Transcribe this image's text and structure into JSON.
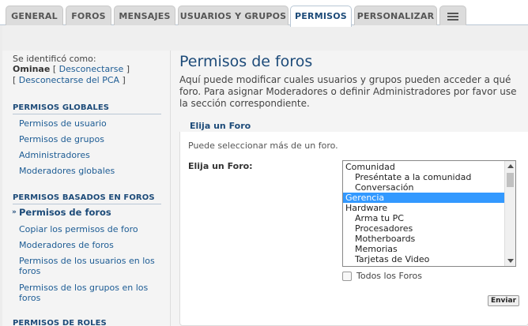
{
  "tabs": [
    {
      "label": "GENERAL",
      "active": false
    },
    {
      "label": "FOROS",
      "active": false
    },
    {
      "label": "MENSAJES",
      "active": false
    },
    {
      "label": "USUARIOS Y GRUPOS",
      "active": false
    },
    {
      "label": "PERMISOS",
      "active": true
    },
    {
      "label": "PERSONALIZAR",
      "active": false
    }
  ],
  "tab_menu_icon": "hamburger-menu-icon",
  "sidebar": {
    "identified_as": "Se identificó como:",
    "username": "Ominae",
    "logout_link": "Desconectarse",
    "logout_pca_link": "Desconectarse del PCA",
    "bracket_open": "[",
    "bracket_close": "]",
    "sections": [
      {
        "title": "PERMISOS GLOBALES",
        "items": [
          {
            "label": "Permisos de usuario"
          },
          {
            "label": "Permisos de grupos"
          },
          {
            "label": "Administradores"
          },
          {
            "label": "Moderadores globales"
          }
        ]
      },
      {
        "title": "PERMISOS BASADOS EN FOROS",
        "items": [
          {
            "label": "Permisos de foros",
            "active": true
          },
          {
            "label": "Copiar los permisos de foro"
          },
          {
            "label": "Moderadores de foros"
          },
          {
            "label": "Permisos de los usuarios en los foros"
          },
          {
            "label": "Permisos de los grupos en los foros"
          }
        ]
      },
      {
        "title": "PERMISOS DE ROLES",
        "items": []
      }
    ],
    "active_bullet": "»"
  },
  "main": {
    "title": "Permisos de foros",
    "description": "Aquí puede modificar cuales usuarios y grupos pueden acceder a qué foro. Para asignar Moderadores o definir Administradores por favor use la sección correspondiente.",
    "fieldset_legend": "Elija un Foro",
    "hint": "Puede seleccionar más de un foro.",
    "field_label": "Elija un Foro:",
    "forum_options": [
      {
        "label": "Comunidad",
        "indent": 0,
        "selected": false
      },
      {
        "label": "Preséntate a la comunidad",
        "indent": 1,
        "selected": false
      },
      {
        "label": "Conversación",
        "indent": 1,
        "selected": false
      },
      {
        "label": "Gerencia",
        "indent": 0,
        "selected": true
      },
      {
        "label": "Hardware",
        "indent": 0,
        "selected": false
      },
      {
        "label": "Arma tu PC",
        "indent": 1,
        "selected": false
      },
      {
        "label": "Procesadores",
        "indent": 1,
        "selected": false
      },
      {
        "label": "Motherboards",
        "indent": 1,
        "selected": false
      },
      {
        "label": "Memorias",
        "indent": 1,
        "selected": false
      },
      {
        "label": "Tarjetas de Video",
        "indent": 1,
        "selected": false
      }
    ],
    "all_forums_label": "Todos los Foros",
    "all_forums_checked": false,
    "submit_label": "Enviar"
  },
  "colors": {
    "accent": "#1d4b79",
    "link": "#1d5c94",
    "selection": "#3399ff"
  }
}
